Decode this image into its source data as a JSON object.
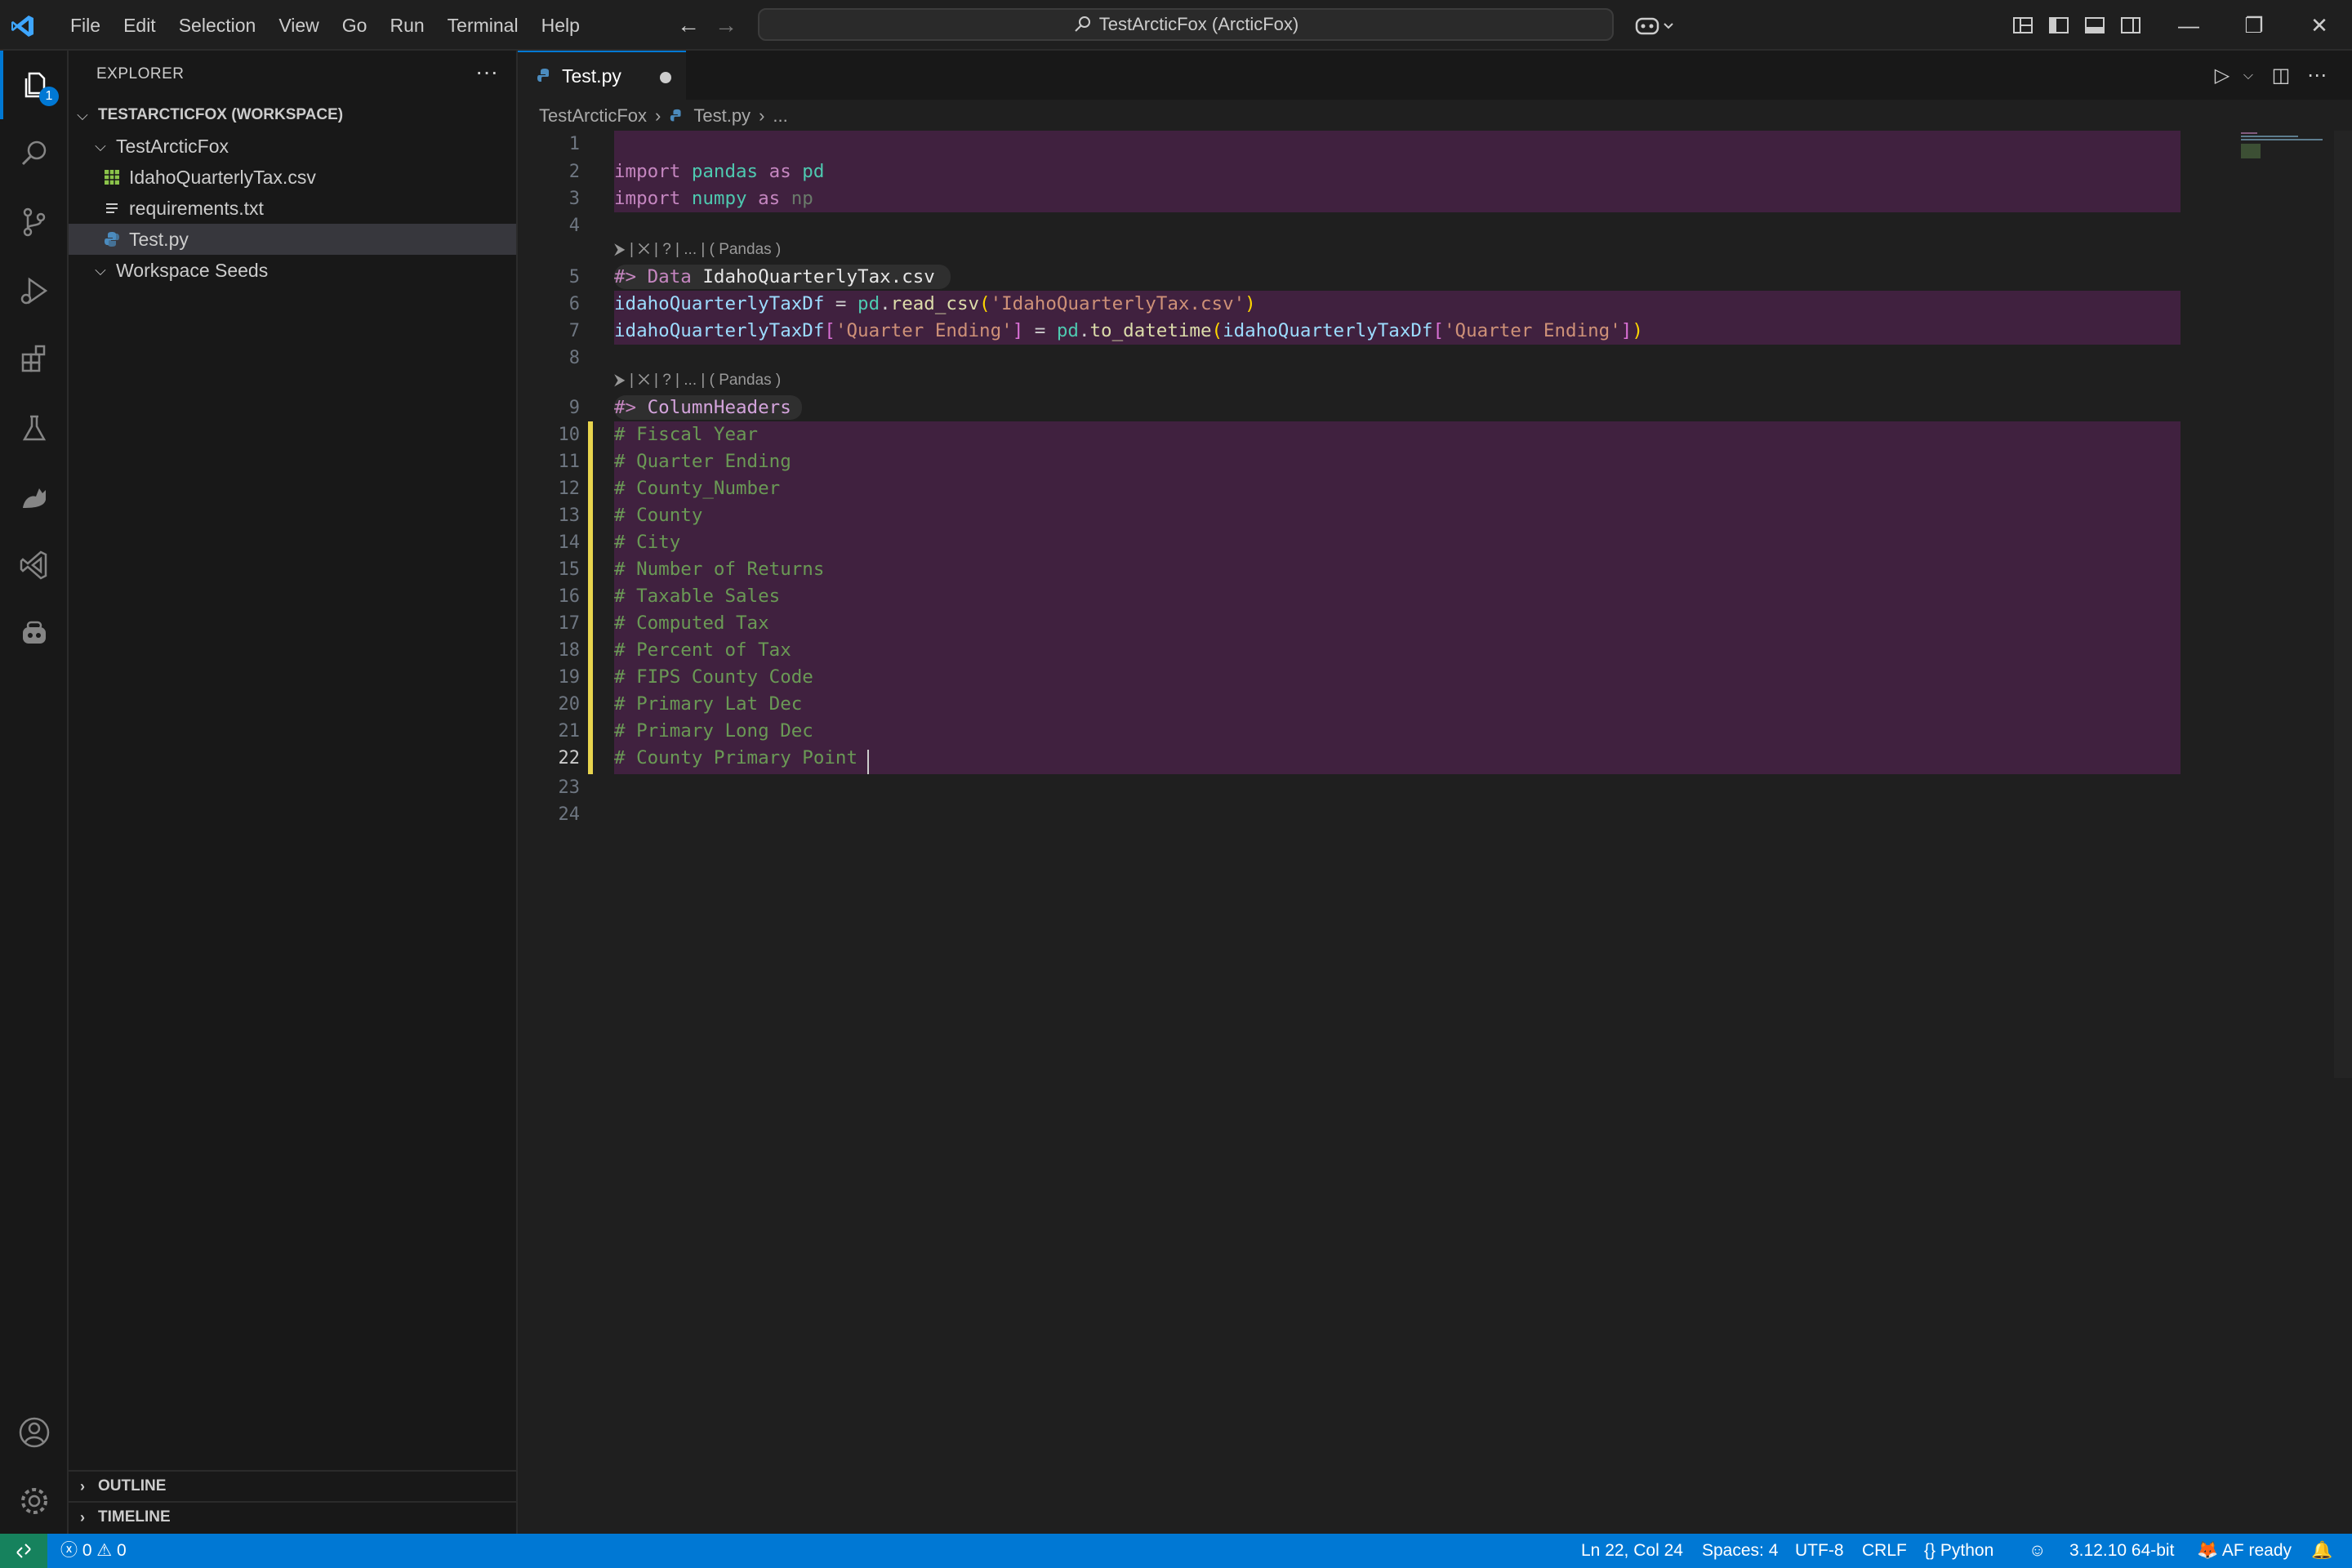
{
  "menu": [
    "File",
    "Edit",
    "Selection",
    "View",
    "Go",
    "Run",
    "Terminal",
    "Help"
  ],
  "search": {
    "text": "TestArcticFox (ArcticFox)"
  },
  "activity": {
    "explorer_badge": "1"
  },
  "sidebar": {
    "title": "EXPLORER",
    "more": "···",
    "workspace": "TESTARCTICFOX (WORKSPACE)",
    "folder": "TestArcticFox",
    "files": [
      "IdahoQuarterlyTax.csv",
      "requirements.txt",
      "Test.py"
    ],
    "seeds": "Workspace Seeds",
    "outline": "OUTLINE",
    "timeline": "TIMELINE"
  },
  "tab": {
    "label": "Test.py"
  },
  "breadcrumb": {
    "folder": "TestArcticFox",
    "file": "Test.py",
    "more": "..."
  },
  "editor": {
    "line_numbers": [
      "1",
      "2",
      "3",
      "4",
      "5",
      "6",
      "7",
      "8",
      "9",
      "10",
      "11",
      "12",
      "13",
      "14",
      "15",
      "16",
      "17",
      "18",
      "19",
      "20",
      "21",
      "22",
      "23",
      "24"
    ],
    "current_line": "22",
    "lens_text": "⮞ | ✕ | ? | ... | ( Pandas )",
    "line2": {
      "kw": "import",
      "mod": "pandas",
      "as": "as",
      "alias": "pd"
    },
    "line3": {
      "kw": "import",
      "mod": "numpy",
      "as": "as",
      "alias": "np"
    },
    "line5": {
      "marker": "#>",
      "word": "Data",
      "name": "IdahoQuarterlyTax.csv"
    },
    "line6": {
      "var": "idahoQuarterlyTaxDf",
      "eq": " = ",
      "mod": "pd",
      "dot": ".",
      "fn": "read_csv",
      "open": "(",
      "str": "'IdahoQuarterlyTax.csv'",
      "close": ")"
    },
    "line7": {
      "var": "idahoQuarterlyTaxDf",
      "b1": "[",
      "str1": "'Quarter Ending'",
      "b2": "]",
      "eq": " = ",
      "mod": "pd",
      "dot": ".",
      "fn": "to_datetime",
      "open": "(",
      "var2": "idahoQuarterlyTaxDf",
      "b3": "[",
      "str2": "'Quarter Ending'",
      "b4": "]",
      "close": ")"
    },
    "line9": {
      "marker": "#>",
      "name": "ColumnHeaders"
    },
    "comments": [
      "# Fiscal Year",
      "# Quarter Ending",
      "# County_Number",
      "# County",
      "# City",
      "# Number of Returns",
      "# Taxable Sales",
      "# Computed Tax",
      "# Percent of Tax",
      "# FIPS County Code",
      "# Primary Lat Dec",
      "# Primary Long Dec",
      "# County Primary Point "
    ]
  },
  "status": {
    "errors": "0",
    "warnings": "0",
    "position": "Ln 22, Col 24",
    "spaces": "Spaces: 4",
    "encoding": "UTF-8",
    "eol": "CRLF",
    "language": "Python",
    "interpreter": "3.12.10 64-bit",
    "af": "AF ready"
  },
  "colors": {
    "accent": "#0078d4",
    "cell_bg": "#40213f",
    "modified": "#e8d44d",
    "remote": "#16825d"
  }
}
